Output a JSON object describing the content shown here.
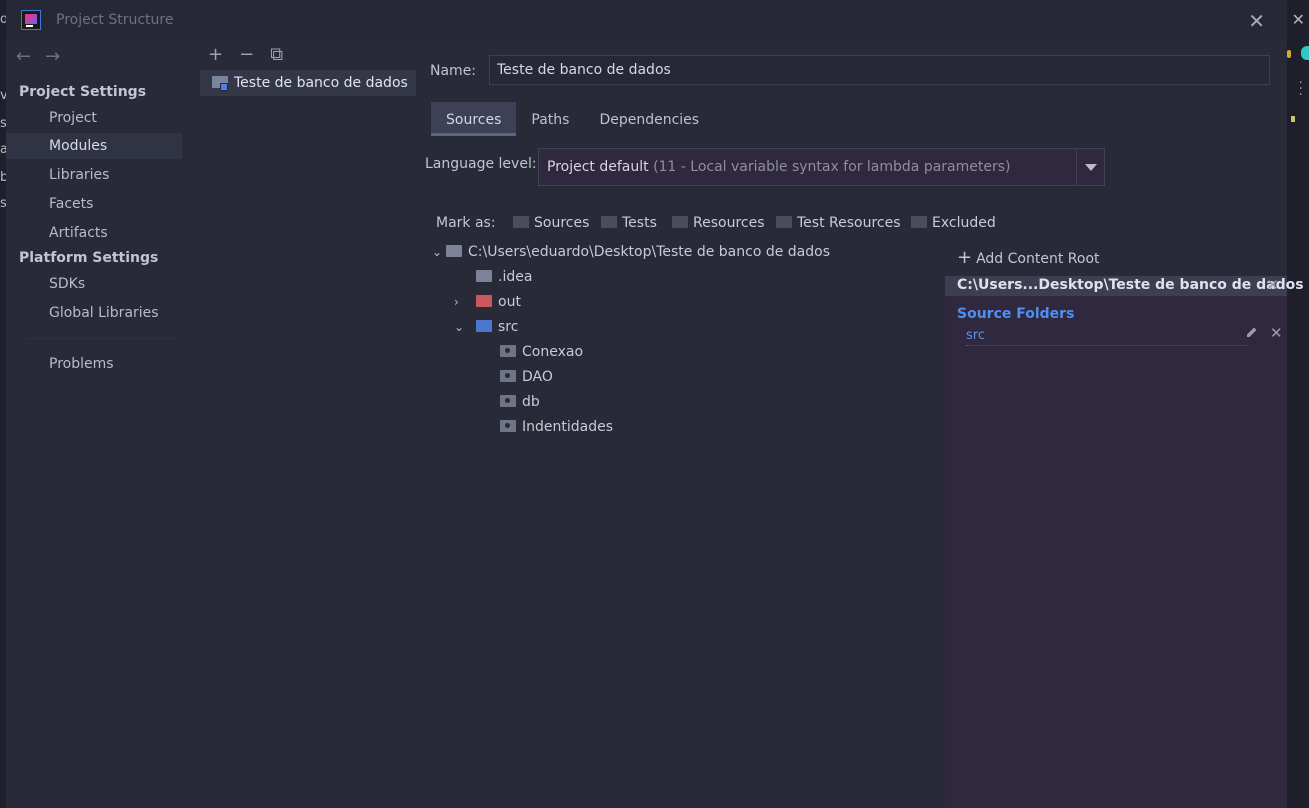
{
  "window": {
    "title": "Project Structure"
  },
  "sidebar": {
    "project_settings_heading": "Project Settings",
    "project_items": [
      "Project",
      "Modules",
      "Libraries",
      "Facets",
      "Artifacts"
    ],
    "platform_settings_heading": "Platform Settings",
    "platform_items": [
      "SDKs",
      "Global Libraries"
    ],
    "problems": "Problems"
  },
  "modules": {
    "items": [
      "Teste de banco de dados"
    ]
  },
  "main": {
    "name_label": "Name:",
    "name_value": "Teste de banco de dados",
    "tabs": [
      "Sources",
      "Paths",
      "Dependencies"
    ],
    "language_label": "Language level:",
    "language_value": "Project default",
    "language_detail": "(11 - Local variable syntax for lambda parameters)",
    "mark_as_label": "Mark as:",
    "mark_as": [
      "Sources",
      "Tests",
      "Resources",
      "Test Resources",
      "Excluded"
    ],
    "tree": {
      "root": "C:\\Users\\eduardo\\Desktop\\Teste de banco de dados",
      "children": [
        ".idea",
        "out",
        "src"
      ],
      "src_children": [
        "Conexao",
        "DAO",
        "db",
        "Indentidades"
      ]
    },
    "content_root": {
      "add_label": "Add Content Root",
      "path": "C:\\Users...Desktop\\Teste de banco de dados",
      "source_folders_heading": "Source Folders",
      "source_folders": [
        "src"
      ]
    }
  },
  "colors": {
    "accent_link": "#4f8ff0",
    "excluded_folder": "#c9595f",
    "source_folder": "#4a78cf"
  }
}
